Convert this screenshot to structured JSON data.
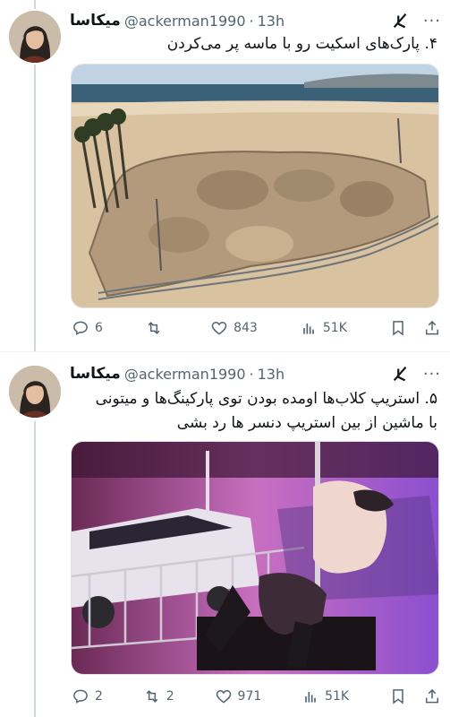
{
  "tweets": [
    {
      "name": "میکاسا",
      "handle": "@ackerman1990",
      "dot": "·",
      "time": "13h",
      "text": "۴. پارک‌های اسکیت رو با ماسه پر می‌کردن",
      "image_desc": "skate-park-filled-with-sand",
      "actions": {
        "replies": "6",
        "retweets": "",
        "likes": "843",
        "views": "51K"
      }
    },
    {
      "name": "میکاسا",
      "handle": "@ackerman1990",
      "dot": "·",
      "time": "13h",
      "text_line1": "۵. استریپ کلاب‌ها اومده بودن توی پارکینگ‌ها و میتونی",
      "text_line2": "با ماشین از بین استریپ دنسر ها رد بشی",
      "image_desc": "drive-through-strip-club",
      "actions": {
        "replies": "2",
        "retweets": "2",
        "likes": "971",
        "views": "51K"
      }
    }
  ],
  "colors": {
    "text": "#0f1419",
    "muted": "#536471",
    "line": "#cfd9de"
  },
  "more_glyph": "···"
}
